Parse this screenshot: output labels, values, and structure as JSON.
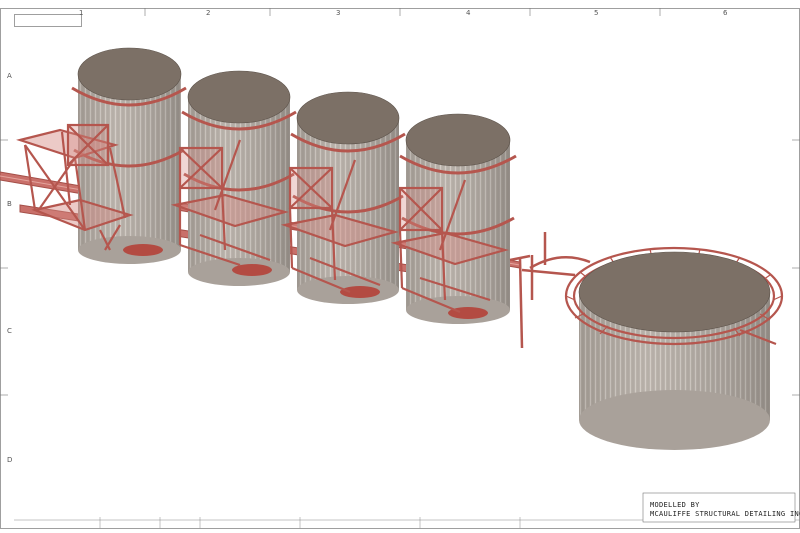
{
  "sheet": {
    "columns": [
      "1",
      "2",
      "3",
      "4",
      "5",
      "6"
    ],
    "rows": [
      "A",
      "B",
      "C",
      "D"
    ],
    "credit_line_1": "MODELLED BY",
    "credit_line_2": "MCAULIFFE STRUCTURAL DETAILING INC."
  },
  "colors": {
    "steel": "#c9706a",
    "steel_dark": "#a44f48",
    "tank_roof": "#7c7066",
    "tank_wall": "#b8b0a8",
    "border": "#777777"
  },
  "model": {
    "silos": 4,
    "large_tank": 1,
    "components": [
      "silo-1",
      "silo-2",
      "silo-3",
      "silo-4",
      "large-tank",
      "conveyor-gallery",
      "pipe-rack",
      "ring-walkway"
    ]
  }
}
